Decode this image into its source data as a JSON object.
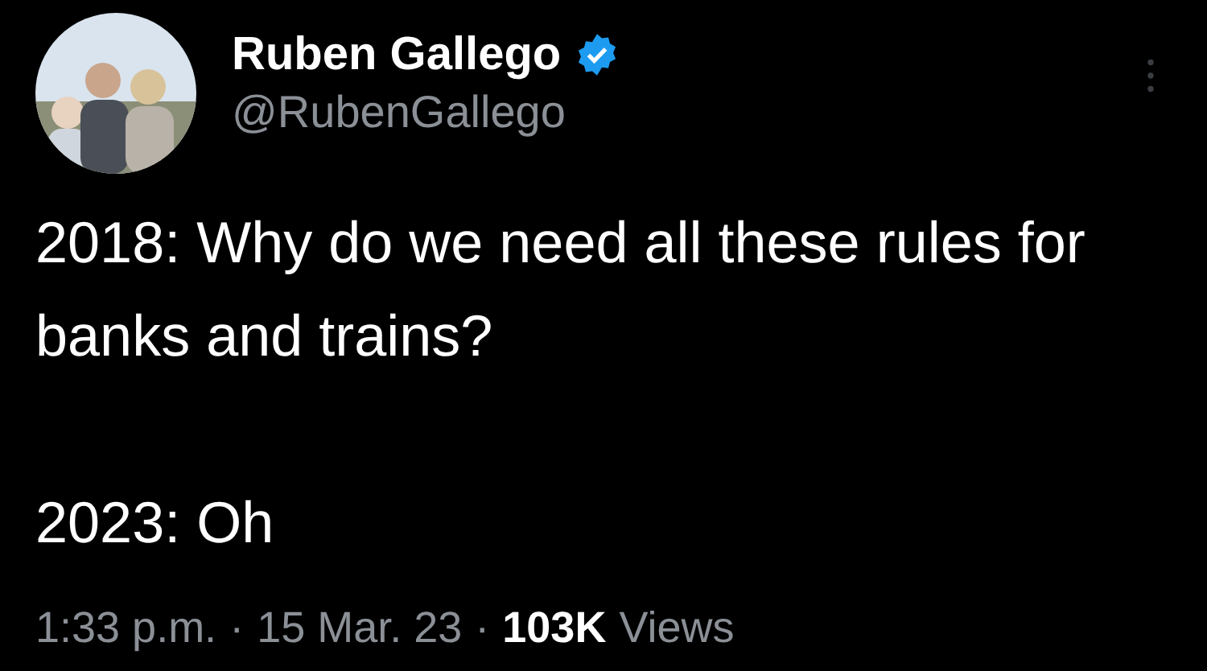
{
  "author": {
    "name": "Ruben Gallego",
    "handle": "@RubenGallego",
    "verified": true
  },
  "paragraphs": [
    "2018: Why do we need all these rules for banks and trains?",
    "2023: Oh"
  ],
  "meta": [
    {
      "kind": "plain",
      "text": "1:33 p.m."
    },
    {
      "kind": "separator",
      "text": "·"
    },
    {
      "kind": "plain",
      "text": "15 Mar. 23"
    },
    {
      "kind": "separator",
      "text": "·"
    },
    {
      "kind": "count",
      "text": "103K"
    },
    {
      "kind": "plain",
      "text": "Views"
    }
  ]
}
